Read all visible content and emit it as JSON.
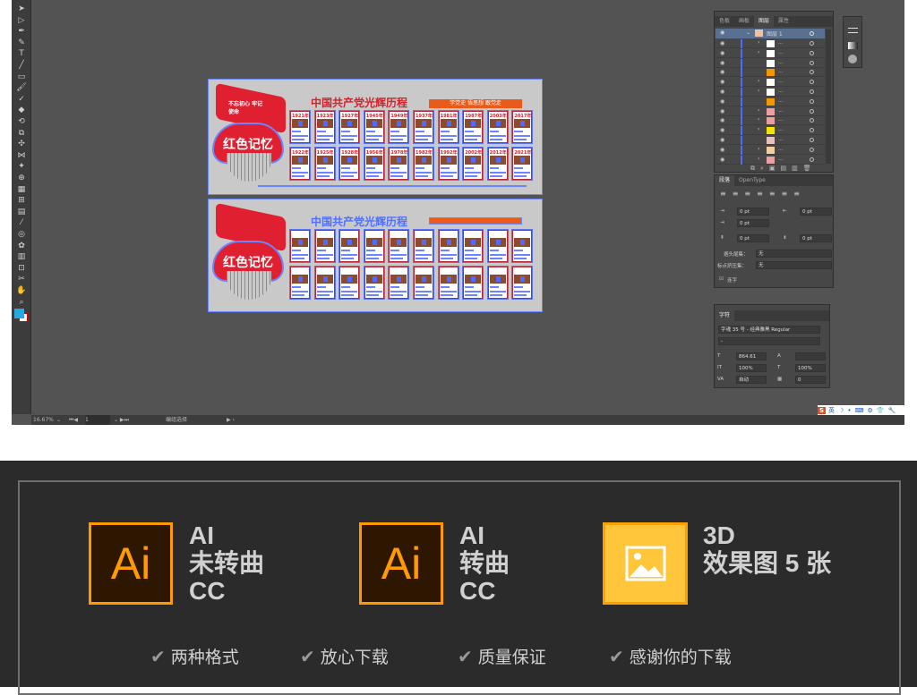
{
  "app": {
    "tools": [
      "selection",
      "direct-selection",
      "pen",
      "curvature",
      "type",
      "line",
      "rectangle",
      "paintbrush",
      "shaper",
      "eraser",
      "rotate",
      "scale",
      "warp",
      "width",
      "puppet",
      "shape-builder",
      "perspective",
      "mesh",
      "gradient",
      "eyedropper",
      "blend",
      "symbol-sprayer",
      "column-graph",
      "artboard",
      "slice",
      "hand",
      "zoom"
    ],
    "fill_color": "#29a8e0",
    "status": {
      "zoom": "16.67%",
      "artboard_num": "1",
      "tool_name": "编组选择"
    }
  },
  "artboards": [
    {
      "flag_text": "不忘初心 牢记使命",
      "badge": "红色记忆",
      "title": "中国共产党光辉历程",
      "slogan": "学党史 悟思想 跟党走",
      "row1": [
        "1921年",
        "1923年",
        "1927年",
        "1945年",
        "1949年",
        "1937年",
        "1981年",
        "1987年",
        "2003年",
        "2017年"
      ],
      "row2": [
        "1922年",
        "1925年",
        "1928年",
        "1956年",
        "1978年",
        "1982年",
        "1992年",
        "2002年",
        "2012年",
        "2021年"
      ]
    },
    {
      "flag_text": "",
      "badge": "红色记忆",
      "title": "中国共产党光辉历程",
      "slogan": "",
      "row1": [
        "",
        "",
        "",
        "",
        "",
        "",
        "",
        "",
        "",
        ""
      ],
      "row2": [
        "",
        "",
        "",
        "",
        "",
        "",
        "",
        "",
        "",
        ""
      ]
    }
  ],
  "layers_panel": {
    "tabs": [
      "色板",
      "画板",
      "图层",
      "属性"
    ],
    "active_tab": "图层",
    "top_layer": "图层 1",
    "rows": [
      {
        "expand": true,
        "thumb": "#ffffff"
      },
      {
        "expand": true,
        "thumb": "#ffffff"
      },
      {
        "expand": false,
        "thumb": "#ffffff"
      },
      {
        "expand": false,
        "thumb": "#f39800"
      },
      {
        "expand": true,
        "thumb": "#ffffff"
      },
      {
        "expand": true,
        "thumb": "#ffffff"
      },
      {
        "expand": false,
        "thumb": "#f39800"
      },
      {
        "expand": true,
        "thumb": "#e8a0a0"
      },
      {
        "expand": true,
        "thumb": "#e8a0a0"
      },
      {
        "expand": true,
        "thumb": "#f2e600"
      },
      {
        "expand": false,
        "thumb": "#e8c0c0"
      },
      {
        "expand": true,
        "thumb": "#f0d0a0"
      },
      {
        "expand": true,
        "thumb": "#e8a0a0"
      }
    ],
    "row_label": "..."
  },
  "paragraph_panel": {
    "tabs": [
      "段落",
      "OpenType"
    ],
    "left_indent": "0 pt",
    "right_indent": "0 pt",
    "first_indent": "0 pt",
    "space_before": "0 pt",
    "space_after": "0 pt",
    "kinsoku_label": "避头尾集：",
    "kinsoku_value": "无",
    "mojikumi_label": "标点挤压集：",
    "mojikumi_value": "无",
    "hyphenate_label": "连字",
    "hyphenate_checked": true
  },
  "character_panel": {
    "tab": "字符",
    "font": "字魂 35 号 - 经典雅黑 Regular",
    "style": "-",
    "size": "864.61",
    "leading": "",
    "vscale": "100%",
    "hscale": "100%",
    "kerning": "自动",
    "tracking": "0"
  },
  "ime": {
    "label": "英"
  },
  "features": [
    {
      "icon": "Ai",
      "lines": [
        "AI",
        "未转曲",
        "CC"
      ]
    },
    {
      "icon": "Ai",
      "lines": [
        "AI",
        "转曲",
        "CC"
      ]
    },
    {
      "icon": "image",
      "lines": [
        "3D",
        "效果图 5 张"
      ]
    }
  ],
  "checks": [
    "两种格式",
    "放心下载",
    "质量保证",
    "感谢你的下载"
  ],
  "colors": {
    "ai_orange": "#ff9a00",
    "ai_bg": "#2d1700",
    "image_tile": "#ffc63c",
    "accent_red": "#d8202a"
  }
}
